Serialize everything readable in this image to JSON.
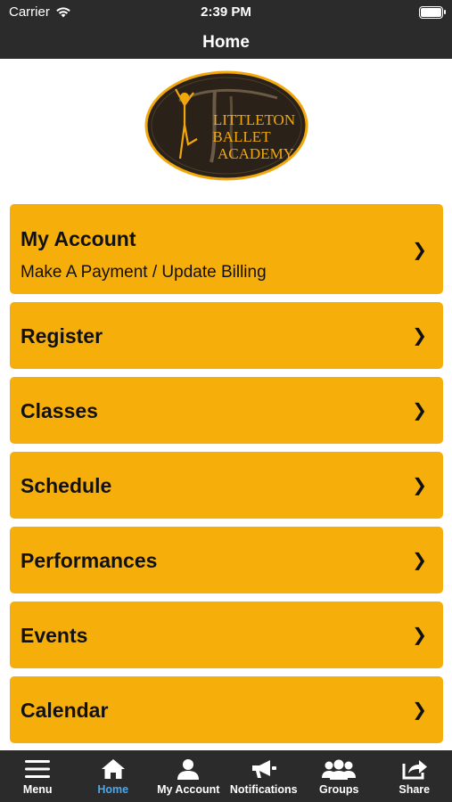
{
  "status_bar": {
    "carrier": "Carrier",
    "time": "2:39 PM"
  },
  "nav": {
    "title": "Home"
  },
  "logo": {
    "line1": "LITTLETON",
    "line2": "BALLET",
    "line3": "ACADEMY"
  },
  "menu": {
    "items": [
      {
        "label": "My Account",
        "sublabel": "Make A Payment / Update Billing",
        "chevron": "❯"
      },
      {
        "label": "Register",
        "chevron": "❯"
      },
      {
        "label": "Classes",
        "chevron": "❯"
      },
      {
        "label": "Schedule",
        "chevron": "❯"
      },
      {
        "label": "Performances",
        "chevron": "❯"
      },
      {
        "label": "Events",
        "chevron": "❯"
      },
      {
        "label": "Calendar",
        "chevron": "❯"
      }
    ]
  },
  "tabs": [
    {
      "label": "Menu",
      "icon": "hamburger-icon"
    },
    {
      "label": "Home",
      "icon": "home-icon",
      "active": true
    },
    {
      "label": "My Account",
      "icon": "person-icon"
    },
    {
      "label": "Notifications",
      "icon": "megaphone-icon"
    },
    {
      "label": "Groups",
      "icon": "group-icon"
    },
    {
      "label": "Share",
      "icon": "share-icon"
    }
  ],
  "colors": {
    "bar": "#2b2b2b",
    "accent": "#f6ae0b",
    "active_tab": "#49a9f0"
  }
}
